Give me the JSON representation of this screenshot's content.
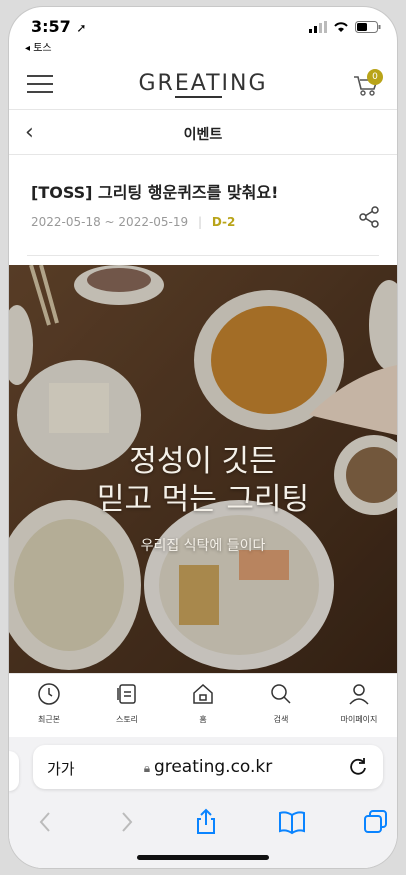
{
  "status": {
    "time": "3:57",
    "back_app": "◂ 토스"
  },
  "header": {
    "logo_pre": "GR",
    "logo_mid": "EAT",
    "logo_post": "ING",
    "cart_count": "0"
  },
  "subheader": {
    "title": "이벤트"
  },
  "event": {
    "title": "[TOSS] 그리팅 행운퀴즈를 맞춰요!",
    "dates": "2022-05-18 ~ 2022-05-19",
    "separator": "|",
    "dday": "D-2"
  },
  "banner": {
    "line1": "정성이 깃든",
    "line2": "믿고 먹는 그리팅",
    "line3": "우리집 식탁에 들이다"
  },
  "bottom_nav": [
    {
      "label": "최근본",
      "icon": "clock-icon"
    },
    {
      "label": "스토리",
      "icon": "story-icon"
    },
    {
      "label": "홈",
      "icon": "home-icon"
    },
    {
      "label": "검색",
      "icon": "search-icon"
    },
    {
      "label": "마이페이지",
      "icon": "person-icon"
    }
  ],
  "browser": {
    "text_size": "가가",
    "url": "greating.co.kr"
  },
  "colors": {
    "accent": "#b9a419",
    "ios_blue": "#0a84ff"
  }
}
